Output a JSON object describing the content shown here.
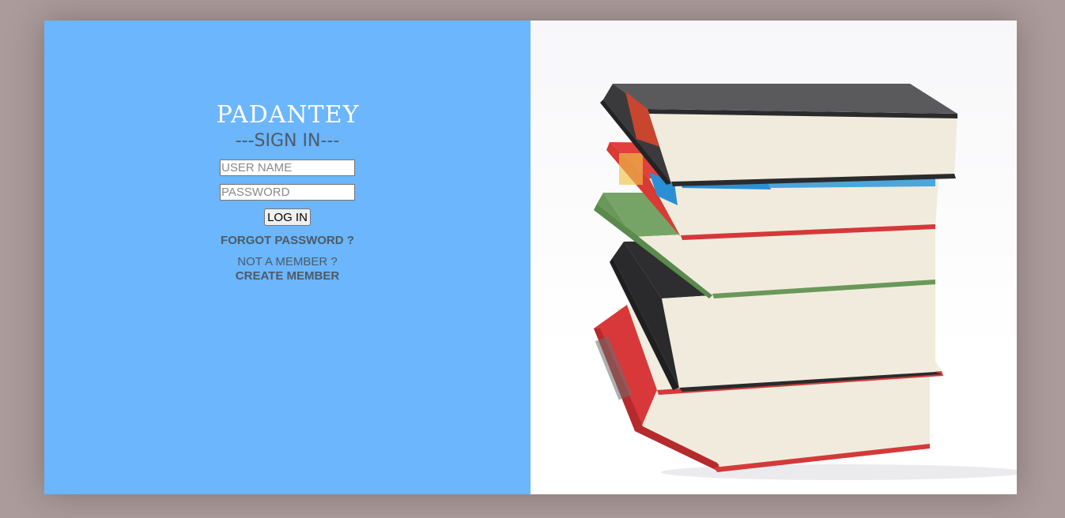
{
  "login": {
    "brand": "PADANTEY",
    "heading": "---SIGN IN---",
    "username_placeholder": "USER NAME",
    "password_placeholder": "PASSWORD",
    "login_button": "LOG IN",
    "forgot_password": "FORGOT PASSWORD ?",
    "not_member": "NOT A MEMBER ?",
    "create_member": "CREATE MEMBER"
  },
  "hero": {
    "image": "stack-of-books-photo"
  },
  "colors": {
    "page_background": "#ab9b9b",
    "panel_blue": "#6bb6fd",
    "text_dark": "#4d5a66"
  }
}
